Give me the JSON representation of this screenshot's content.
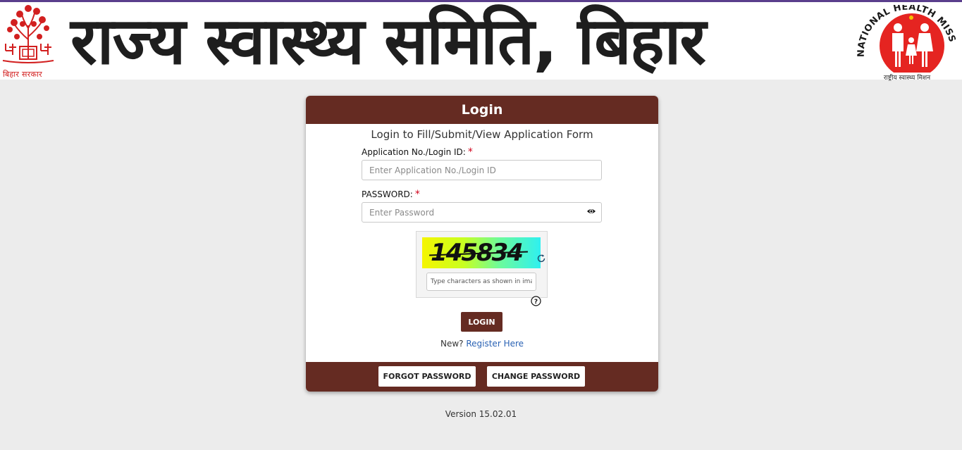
{
  "banner": {
    "title": "राज्य स्वास्थ्य समिति, बिहार",
    "left_logo_caption": "बिहार सरकार",
    "right_logo_ring_text": "NATIONAL HEALTH MISSION",
    "right_logo_caption": "राष्ट्रीय स्वास्थ्य मिशन",
    "left_logo_icon": "bodhi-tree-emblem-icon",
    "right_logo_icon": "family-icon"
  },
  "login_card": {
    "header": "Login",
    "subtitle": "Login to Fill/Submit/View Application Form",
    "app_id_label": "Application No./Login ID:",
    "app_id_required": "*",
    "app_id_placeholder": "Enter Application No./Login ID",
    "password_label": "PASSWORD:",
    "password_required": "*",
    "password_placeholder": "Enter Password",
    "eye_icon": "eye-icon",
    "captcha": {
      "code": "145834",
      "input_placeholder": "Type characters as shown in image",
      "refresh_icon": "refresh-icon",
      "help_icon": "question-mark-icon"
    },
    "login_button": "LOGIN",
    "new_text": "New?",
    "register_link": "Register Here",
    "forgot_password_button": "FORGOT PASSWORD",
    "change_password_button": "CHANGE PASSWORD"
  },
  "version": "Version 15.02.01",
  "colors": {
    "brand_maroon": "#652b22",
    "banner_top_border": "#5a3e8c",
    "link": "#2a62b4",
    "required": "#d0021b",
    "page_bg": "#ececec"
  }
}
